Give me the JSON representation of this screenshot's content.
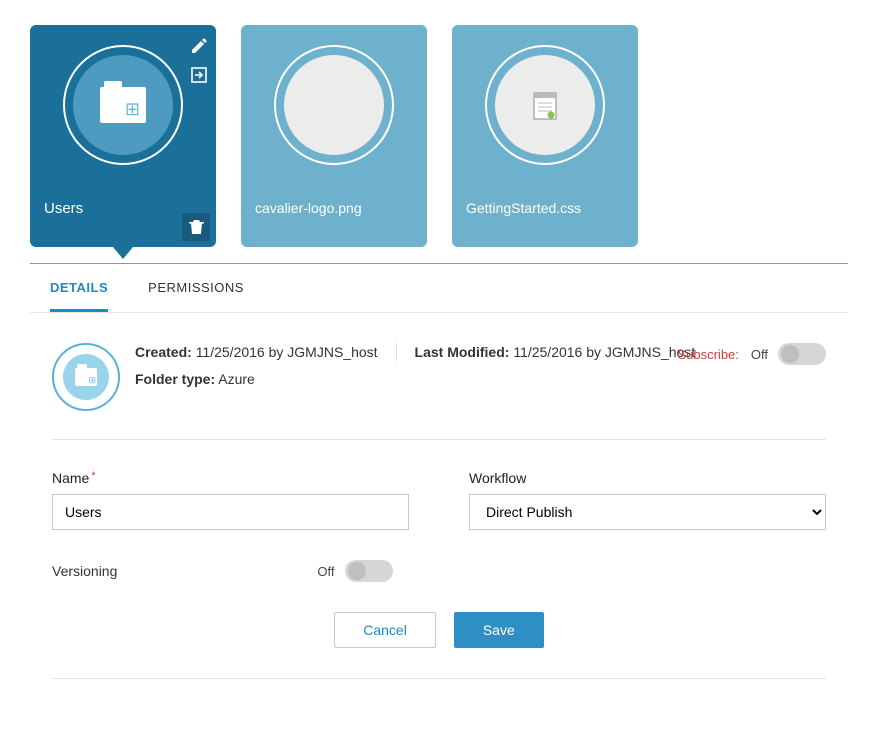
{
  "cards": [
    {
      "label": "Users"
    },
    {
      "label": "cavalier-logo.png"
    },
    {
      "label": "GettingStarted.css"
    }
  ],
  "tabs": {
    "details": "DETAILS",
    "permissions": "PERMISSIONS"
  },
  "header": {
    "created_k": "Created:",
    "created_v": "11/25/2016 by JGMJNS_host",
    "modified_k": "Last Modified:",
    "modified_v": "11/25/2016 by JGMJNS_host",
    "type_k": "Folder type:",
    "type_v": "Azure",
    "subscribe": "Subscribe:"
  },
  "toggle": {
    "off": "Off"
  },
  "form": {
    "name_label": "Name",
    "name_value": "Users",
    "workflow_label": "Workflow",
    "workflow_value": "Direct Publish",
    "versioning_label": "Versioning"
  },
  "buttons": {
    "cancel": "Cancel",
    "save": "Save"
  }
}
